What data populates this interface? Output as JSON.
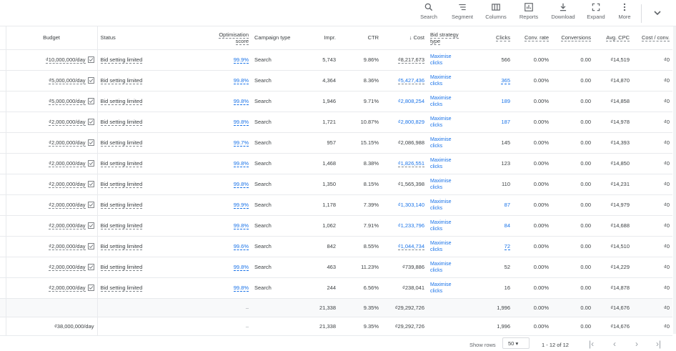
{
  "toolbar": {
    "search": "Search",
    "segment": "Segment",
    "columns": "Columns",
    "reports": "Reports",
    "download": "Download",
    "expand": "Expand",
    "more": "More"
  },
  "headers": {
    "budget": "Budget",
    "status": "Status",
    "opt1": "Optimisation",
    "opt2": "score",
    "campaign_type": "Campaign type",
    "impr": "Impr.",
    "ctr": "CTR",
    "cost": "Cost",
    "bid1": "Bid strategy",
    "bid2": "type",
    "clicks": "Clicks",
    "conv_rate": "Conv. rate",
    "conversions": "Conversions",
    "avg_cpc": "Avg. CPC",
    "cost_conv": "Cost / conv."
  },
  "rows": [
    {
      "budget": "₫10,000,000/day",
      "status": "Bid setting limited",
      "opt": "99.9%",
      "type": "Search",
      "impr": "5,743",
      "ctr": "9.86%",
      "cost": "₫8,217,673",
      "bid1": "Maximise",
      "bid2": "clicks",
      "clicks": "566",
      "conv_rate": "0.00%",
      "conversions": "0.00",
      "avg_cpc": "₫14,519",
      "cost_conv": "₫0"
    },
    {
      "budget": "₫5,000,000/day",
      "status": "Bid setting limited",
      "opt": "99.8%",
      "type": "Search",
      "impr": "4,364",
      "ctr": "8.36%",
      "cost": "₫5,427,436",
      "bid1": "Maximise",
      "bid2": "clicks",
      "clicks": "365",
      "conv_rate": "0.00%",
      "conversions": "0.00",
      "avg_cpc": "₫14,870",
      "cost_conv": "₫0"
    },
    {
      "budget": "₫5,000,000/day",
      "status": "Bid setting limited",
      "opt": "99.8%",
      "type": "Search",
      "impr": "1,946",
      "ctr": "9.71%",
      "cost": "₫2,808,254",
      "bid1": "Maximise",
      "bid2": "clicks",
      "clicks": "189",
      "conv_rate": "0.00%",
      "conversions": "0.00",
      "avg_cpc": "₫14,858",
      "cost_conv": "₫0"
    },
    {
      "budget": "₫2,000,000/day",
      "status": "Bid setting limited",
      "opt": "99.8%",
      "type": "Search",
      "impr": "1,721",
      "ctr": "10.87%",
      "cost": "₫2,800,829",
      "bid1": "Maximise",
      "bid2": "clicks",
      "clicks": "187",
      "conv_rate": "0.00%",
      "conversions": "0.00",
      "avg_cpc": "₫14,978",
      "cost_conv": "₫0"
    },
    {
      "budget": "₫2,000,000/day",
      "status": "Bid setting limited",
      "opt": "99.7%",
      "type": "Search",
      "impr": "957",
      "ctr": "15.15%",
      "cost": "₫2,086,988",
      "bid1": "Maximise",
      "bid2": "clicks",
      "clicks": "145",
      "conv_rate": "0.00%",
      "conversions": "0.00",
      "avg_cpc": "₫14,393",
      "cost_conv": "₫0"
    },
    {
      "budget": "₫2,000,000/day",
      "status": "Bid setting limited",
      "opt": "99.8%",
      "type": "Search",
      "impr": "1,468",
      "ctr": "8.38%",
      "cost": "₫1,826,551",
      "bid1": "Maximise",
      "bid2": "clicks",
      "clicks": "123",
      "conv_rate": "0.00%",
      "conversions": "0.00",
      "avg_cpc": "₫14,850",
      "cost_conv": "₫0"
    },
    {
      "budget": "₫2,000,000/day",
      "status": "Bid setting limited",
      "opt": "99.8%",
      "type": "Search",
      "impr": "1,350",
      "ctr": "8.15%",
      "cost": "₫1,565,398",
      "bid1": "Maximise",
      "bid2": "clicks",
      "clicks": "110",
      "conv_rate": "0.00%",
      "conversions": "0.00",
      "avg_cpc": "₫14,231",
      "cost_conv": "₫0"
    },
    {
      "budget": "₫2,000,000/day",
      "status": "Bid setting limited",
      "opt": "99.9%",
      "type": "Search",
      "impr": "1,178",
      "ctr": "7.39%",
      "cost": "₫1,303,140",
      "bid1": "Maximise",
      "bid2": "clicks",
      "clicks": "87",
      "conv_rate": "0.00%",
      "conversions": "0.00",
      "avg_cpc": "₫14,979",
      "cost_conv": "₫0"
    },
    {
      "budget": "₫2,000,000/day",
      "status": "Bid setting limited",
      "opt": "99.8%",
      "type": "Search",
      "impr": "1,062",
      "ctr": "7.91%",
      "cost": "₫1,233,796",
      "bid1": "Maximise",
      "bid2": "clicks",
      "clicks": "84",
      "conv_rate": "0.00%",
      "conversions": "0.00",
      "avg_cpc": "₫14,688",
      "cost_conv": "₫0"
    },
    {
      "budget": "₫2,000,000/day",
      "status": "Bid setting limited",
      "opt": "99.6%",
      "type": "Search",
      "impr": "842",
      "ctr": "8.55%",
      "cost": "₫1,044,734",
      "bid1": "Maximise",
      "bid2": "clicks",
      "clicks": "72",
      "conv_rate": "0.00%",
      "conversions": "0.00",
      "avg_cpc": "₫14,510",
      "cost_conv": "₫0"
    },
    {
      "budget": "₫2,000,000/day",
      "status": "Bid setting limited",
      "opt": "99.8%",
      "type": "Search",
      "impr": "463",
      "ctr": "11.23%",
      "cost": "₫739,886",
      "bid1": "Maximise",
      "bid2": "clicks",
      "clicks": "52",
      "conv_rate": "0.00%",
      "conversions": "0.00",
      "avg_cpc": "₫14,229",
      "cost_conv": "₫0"
    },
    {
      "budget": "₫2,000,000/day",
      "status": "Bid setting limited",
      "opt": "99.8%",
      "type": "Search",
      "impr": "244",
      "ctr": "6.56%",
      "cost": "₫238,041",
      "bid1": "Maximise",
      "bid2": "clicks",
      "clicks": "16",
      "conv_rate": "0.00%",
      "conversions": "0.00",
      "avg_cpc": "₫14,878",
      "cost_conv": "₫0"
    }
  ],
  "summary1": {
    "opt": "–",
    "impr": "21,338",
    "ctr": "9.35%",
    "cost": "₫29,292,726",
    "clicks": "1,996",
    "conv_rate": "0.00%",
    "conversions": "0.00",
    "avg_cpc": "₫14,676",
    "cost_conv": "₫0"
  },
  "summary2": {
    "budget": "₫38,000,000/day",
    "opt": "–",
    "impr": "21,338",
    "ctr": "9.35%",
    "cost": "₫29,292,726",
    "clicks": "1,996",
    "conv_rate": "0.00%",
    "conversions": "0.00",
    "avg_cpc": "₫14,676",
    "cost_conv": "₫0"
  },
  "footer": {
    "show_rows": "Show rows",
    "rows_value": "50",
    "range": "1 - 12 of 12"
  }
}
